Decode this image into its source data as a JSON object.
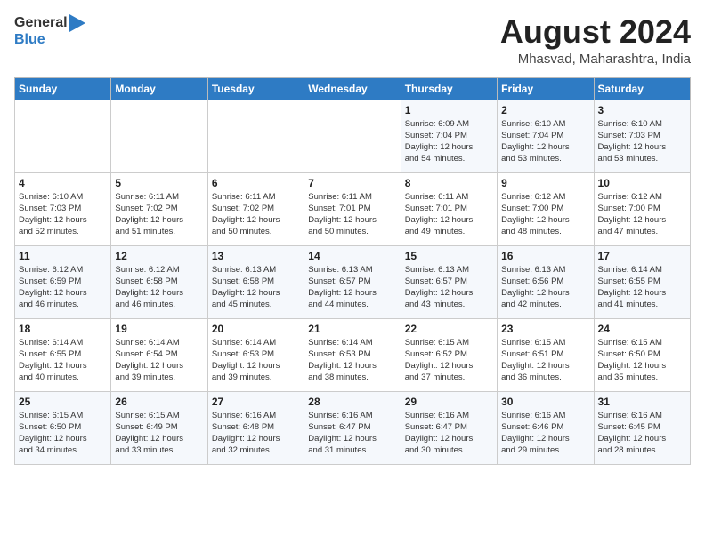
{
  "header": {
    "logo_general": "General",
    "logo_blue": "Blue",
    "month_year": "August 2024",
    "location": "Mhasvad, Maharashtra, India"
  },
  "days_of_week": [
    "Sunday",
    "Monday",
    "Tuesday",
    "Wednesday",
    "Thursday",
    "Friday",
    "Saturday"
  ],
  "weeks": [
    [
      {
        "day": "",
        "info": ""
      },
      {
        "day": "",
        "info": ""
      },
      {
        "day": "",
        "info": ""
      },
      {
        "day": "",
        "info": ""
      },
      {
        "day": "1",
        "info": "Sunrise: 6:09 AM\nSunset: 7:04 PM\nDaylight: 12 hours\nand 54 minutes."
      },
      {
        "day": "2",
        "info": "Sunrise: 6:10 AM\nSunset: 7:04 PM\nDaylight: 12 hours\nand 53 minutes."
      },
      {
        "day": "3",
        "info": "Sunrise: 6:10 AM\nSunset: 7:03 PM\nDaylight: 12 hours\nand 53 minutes."
      }
    ],
    [
      {
        "day": "4",
        "info": "Sunrise: 6:10 AM\nSunset: 7:03 PM\nDaylight: 12 hours\nand 52 minutes."
      },
      {
        "day": "5",
        "info": "Sunrise: 6:11 AM\nSunset: 7:02 PM\nDaylight: 12 hours\nand 51 minutes."
      },
      {
        "day": "6",
        "info": "Sunrise: 6:11 AM\nSunset: 7:02 PM\nDaylight: 12 hours\nand 50 minutes."
      },
      {
        "day": "7",
        "info": "Sunrise: 6:11 AM\nSunset: 7:01 PM\nDaylight: 12 hours\nand 50 minutes."
      },
      {
        "day": "8",
        "info": "Sunrise: 6:11 AM\nSunset: 7:01 PM\nDaylight: 12 hours\nand 49 minutes."
      },
      {
        "day": "9",
        "info": "Sunrise: 6:12 AM\nSunset: 7:00 PM\nDaylight: 12 hours\nand 48 minutes."
      },
      {
        "day": "10",
        "info": "Sunrise: 6:12 AM\nSunset: 7:00 PM\nDaylight: 12 hours\nand 47 minutes."
      }
    ],
    [
      {
        "day": "11",
        "info": "Sunrise: 6:12 AM\nSunset: 6:59 PM\nDaylight: 12 hours\nand 46 minutes."
      },
      {
        "day": "12",
        "info": "Sunrise: 6:12 AM\nSunset: 6:58 PM\nDaylight: 12 hours\nand 46 minutes."
      },
      {
        "day": "13",
        "info": "Sunrise: 6:13 AM\nSunset: 6:58 PM\nDaylight: 12 hours\nand 45 minutes."
      },
      {
        "day": "14",
        "info": "Sunrise: 6:13 AM\nSunset: 6:57 PM\nDaylight: 12 hours\nand 44 minutes."
      },
      {
        "day": "15",
        "info": "Sunrise: 6:13 AM\nSunset: 6:57 PM\nDaylight: 12 hours\nand 43 minutes."
      },
      {
        "day": "16",
        "info": "Sunrise: 6:13 AM\nSunset: 6:56 PM\nDaylight: 12 hours\nand 42 minutes."
      },
      {
        "day": "17",
        "info": "Sunrise: 6:14 AM\nSunset: 6:55 PM\nDaylight: 12 hours\nand 41 minutes."
      }
    ],
    [
      {
        "day": "18",
        "info": "Sunrise: 6:14 AM\nSunset: 6:55 PM\nDaylight: 12 hours\nand 40 minutes."
      },
      {
        "day": "19",
        "info": "Sunrise: 6:14 AM\nSunset: 6:54 PM\nDaylight: 12 hours\nand 39 minutes."
      },
      {
        "day": "20",
        "info": "Sunrise: 6:14 AM\nSunset: 6:53 PM\nDaylight: 12 hours\nand 39 minutes."
      },
      {
        "day": "21",
        "info": "Sunrise: 6:14 AM\nSunset: 6:53 PM\nDaylight: 12 hours\nand 38 minutes."
      },
      {
        "day": "22",
        "info": "Sunrise: 6:15 AM\nSunset: 6:52 PM\nDaylight: 12 hours\nand 37 minutes."
      },
      {
        "day": "23",
        "info": "Sunrise: 6:15 AM\nSunset: 6:51 PM\nDaylight: 12 hours\nand 36 minutes."
      },
      {
        "day": "24",
        "info": "Sunrise: 6:15 AM\nSunset: 6:50 PM\nDaylight: 12 hours\nand 35 minutes."
      }
    ],
    [
      {
        "day": "25",
        "info": "Sunrise: 6:15 AM\nSunset: 6:50 PM\nDaylight: 12 hours\nand 34 minutes."
      },
      {
        "day": "26",
        "info": "Sunrise: 6:15 AM\nSunset: 6:49 PM\nDaylight: 12 hours\nand 33 minutes."
      },
      {
        "day": "27",
        "info": "Sunrise: 6:16 AM\nSunset: 6:48 PM\nDaylight: 12 hours\nand 32 minutes."
      },
      {
        "day": "28",
        "info": "Sunrise: 6:16 AM\nSunset: 6:47 PM\nDaylight: 12 hours\nand 31 minutes."
      },
      {
        "day": "29",
        "info": "Sunrise: 6:16 AM\nSunset: 6:47 PM\nDaylight: 12 hours\nand 30 minutes."
      },
      {
        "day": "30",
        "info": "Sunrise: 6:16 AM\nSunset: 6:46 PM\nDaylight: 12 hours\nand 29 minutes."
      },
      {
        "day": "31",
        "info": "Sunrise: 6:16 AM\nSunset: 6:45 PM\nDaylight: 12 hours\nand 28 minutes."
      }
    ]
  ]
}
